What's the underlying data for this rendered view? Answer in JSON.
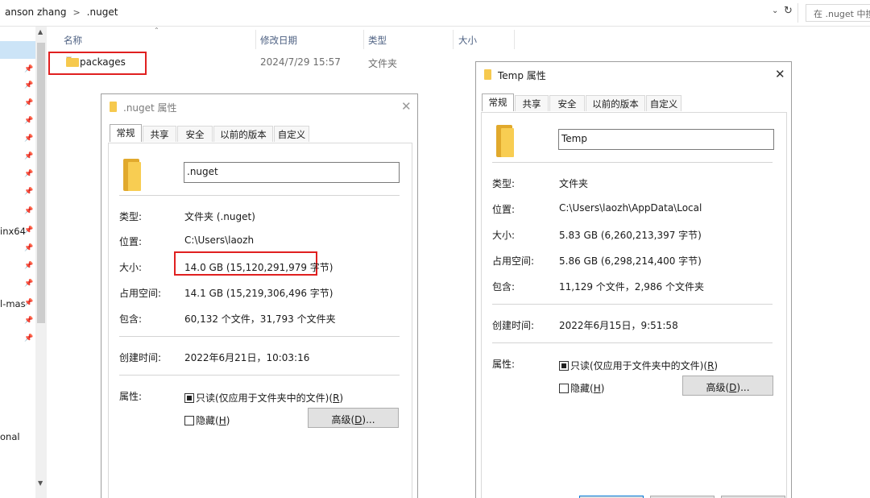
{
  "explorer": {
    "breadcrumb": [
      "anson zhang",
      ".nuget"
    ],
    "search_placeholder": "在 .nuget 中搜",
    "nav_fragments": [
      "inx64",
      "l-mas",
      "onal"
    ],
    "columns": [
      "名称",
      "修改日期",
      "类型",
      "大小"
    ],
    "rows": [
      {
        "name": "packages",
        "modified": "2024/7/29 15:57",
        "type": "文件夹",
        "size": ""
      }
    ]
  },
  "nuget_dialog": {
    "title": ".nuget 属性",
    "tabs": [
      "常规",
      "共享",
      "安全",
      "以前的版本",
      "自定义"
    ],
    "name": ".nuget",
    "labels": {
      "type": "类型:",
      "location": "位置:",
      "size": "大小:",
      "size_on_disk": "占用空间:",
      "contains": "包含:",
      "created": "创建时间:",
      "attributes": "属性:"
    },
    "values": {
      "type": "文件夹 (.nuget)",
      "location": "C:\\Users\\laozh",
      "size": "14.0 GB (15,120,291,979 字节)",
      "size_on_disk": "14.1 GB (15,219,306,496 字节)",
      "contains": "60,132 个文件，31,793 个文件夹",
      "created": "2022年6月21日，10:03:16"
    },
    "readonly_label": "只读(仅应用于文件夹中的文件)",
    "readonly_key": "R",
    "hidden_label": "隐藏",
    "hidden_key": "H",
    "advanced_label": "高级",
    "advanced_key": "D"
  },
  "temp_dialog": {
    "title": "Temp 属性",
    "tabs": [
      "常规",
      "共享",
      "安全",
      "以前的版本",
      "自定义"
    ],
    "name": "Temp",
    "labels": {
      "type": "类型:",
      "location": "位置:",
      "size": "大小:",
      "size_on_disk": "占用空间:",
      "contains": "包含:",
      "created": "创建时间:",
      "attributes": "属性:"
    },
    "values": {
      "type": "文件夹",
      "location": "C:\\Users\\laozh\\AppData\\Local",
      "size": "5.83 GB (6,260,213,397 字节)",
      "size_on_disk": "5.86 GB (6,298,214,400 字节)",
      "contains": "11,129 个文件，2,986 个文件夹",
      "created": "2022年6月15日，9:51:58"
    },
    "readonly_label": "只读(仅应用于文件夹中的文件)",
    "readonly_key": "R",
    "hidden_label": "隐藏",
    "hidden_key": "H",
    "advanced_label": "高级",
    "advanced_key": "D"
  },
  "colors": {
    "highlight_red": "#e02020",
    "selection_blue": "#cce4f7",
    "folder_yellow": "#f6c94e"
  },
  "icons": [
    "folder-icon",
    "pin-icon",
    "close-icon",
    "refresh-icon",
    "chevron-down-icon"
  ]
}
